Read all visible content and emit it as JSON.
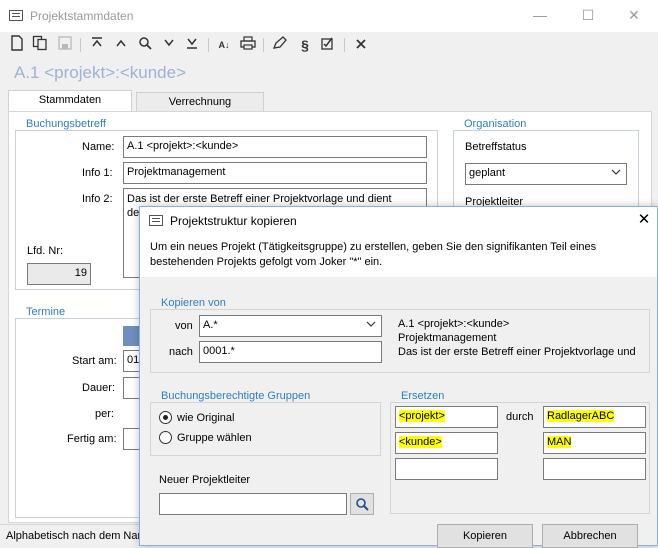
{
  "window": {
    "title": "Projektstammdaten",
    "minimize": "—",
    "maximize": "☐",
    "close": "✕"
  },
  "heading": "A.1 <projekt>:<kunde>",
  "tabs": [
    "Stammdaten",
    "Verrechnung"
  ],
  "buchungsbetreff": {
    "legend": "Buchungsbetreff",
    "name_label": "Name:",
    "name_value": "A.1 <projekt>:<kunde>",
    "info1_label": "Info 1:",
    "info1_value": "Projektmanagement",
    "info2_label": "Info 2:",
    "info2_line1": "Das ist der erste Betreff einer Projektvorlage und dient",
    "info2_line2": "de",
    "lfd_label": "Lfd. Nr:",
    "lfd_value": "19"
  },
  "organisation": {
    "legend": "Organisation",
    "status_label": "Betreffstatus",
    "status_value": "geplant",
    "projektleiter_label": "Projektleiter"
  },
  "termine": {
    "legend": "Termine",
    "start_label": "Start am:",
    "start_value": "01",
    "dauer_label": "Dauer:",
    "per_label": "per:",
    "fertig_label": "Fertig am:"
  },
  "status_bar": "Alphabetisch nach dem Nam",
  "dialog": {
    "title": "Projektstruktur kopieren",
    "close": "✕",
    "description": "Um ein neues Projekt (Tätigkeitsgruppe) zu erstellen, geben Sie den signifikanten Teil eines bestehenden Projekts gefolgt vom Joker \"*\" ein.",
    "kopieren_von": {
      "legend": "Kopieren von",
      "von_label": "von",
      "von_value": "A.*",
      "nach_label": "nach",
      "nach_value": "0001.*",
      "info_line1": "A.1 <projekt>:<kunde>",
      "info_line2": "Projektmanagement",
      "info_line3": "Das ist der erste Betreff einer Projektvorlage und"
    },
    "gruppen": {
      "legend": "Buchungsberechtigte Gruppen",
      "option1": "wie Original",
      "option2": "Gruppe wählen",
      "selected": "wie Original"
    },
    "ersetzen": {
      "legend": "Ersetzen",
      "durch_label": "durch",
      "row1_from": "<projekt>",
      "row1_to": "RadlagerABC",
      "row2_from": "<kunde>",
      "row2_to": "MAN",
      "row3_from": "",
      "row3_to": "",
      "highlight_color": "#ffff00"
    },
    "projektleiter_label": "Neuer Projektleiter",
    "projektleiter_value": "",
    "ok_button": "Kopieren",
    "cancel_button": "Abbrechen"
  },
  "colors": {
    "accent": "#2d7fc4",
    "heading": "#9cb3d3",
    "highlight": "#ffff00"
  }
}
